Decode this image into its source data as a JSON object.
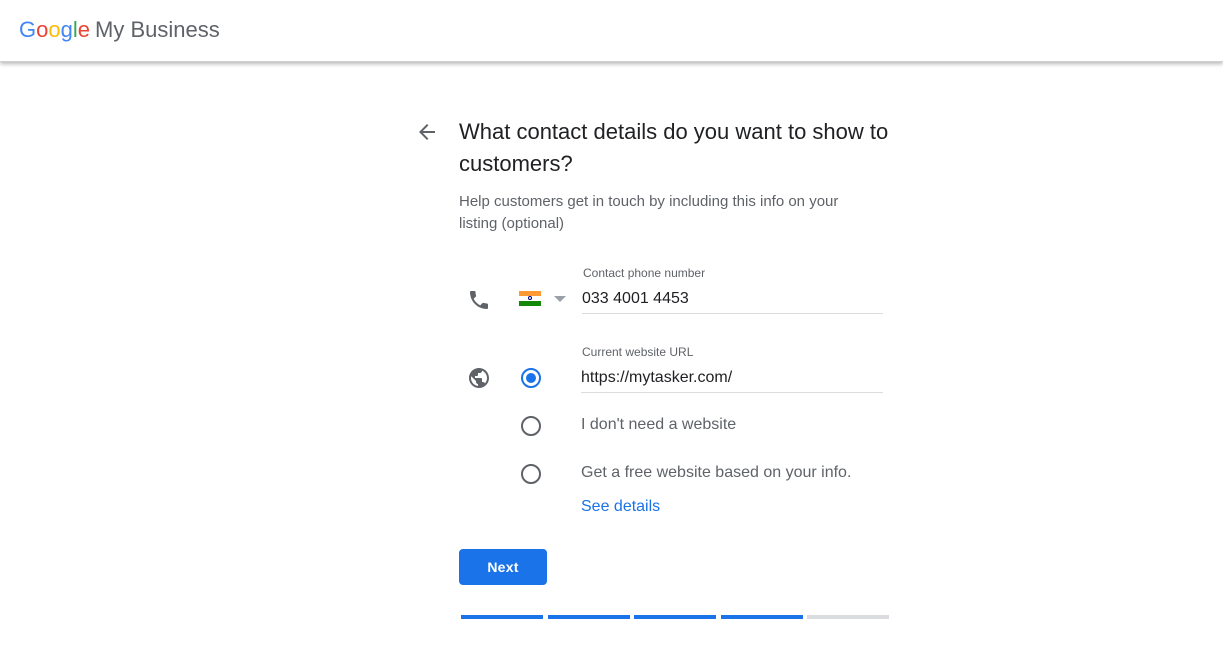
{
  "header": {
    "logo_letters": [
      "G",
      "o",
      "o",
      "g",
      "l",
      "e"
    ],
    "product_name": "My Business"
  },
  "form": {
    "title": "What contact details do you want to show to customers?",
    "subtitle": "Help customers get in touch by including this info on your listing (optional)",
    "phone": {
      "label": "Contact phone number",
      "value": "033 4001 4453",
      "country_flag": "india-flag"
    },
    "website": {
      "label": "Current website URL",
      "value": "https://mytasker.com/",
      "options": [
        {
          "label": "",
          "checked": true
        },
        {
          "label": "I don't need a website",
          "checked": false
        },
        {
          "label": "Get a free website based on your info.",
          "checked": false
        }
      ],
      "see_details_label": "See details"
    },
    "next_label": "Next"
  },
  "progress": {
    "total_steps": 5,
    "completed_steps": 4
  },
  "colors": {
    "accent": "#1a73e8",
    "progress_inactive": "#dadce0"
  }
}
